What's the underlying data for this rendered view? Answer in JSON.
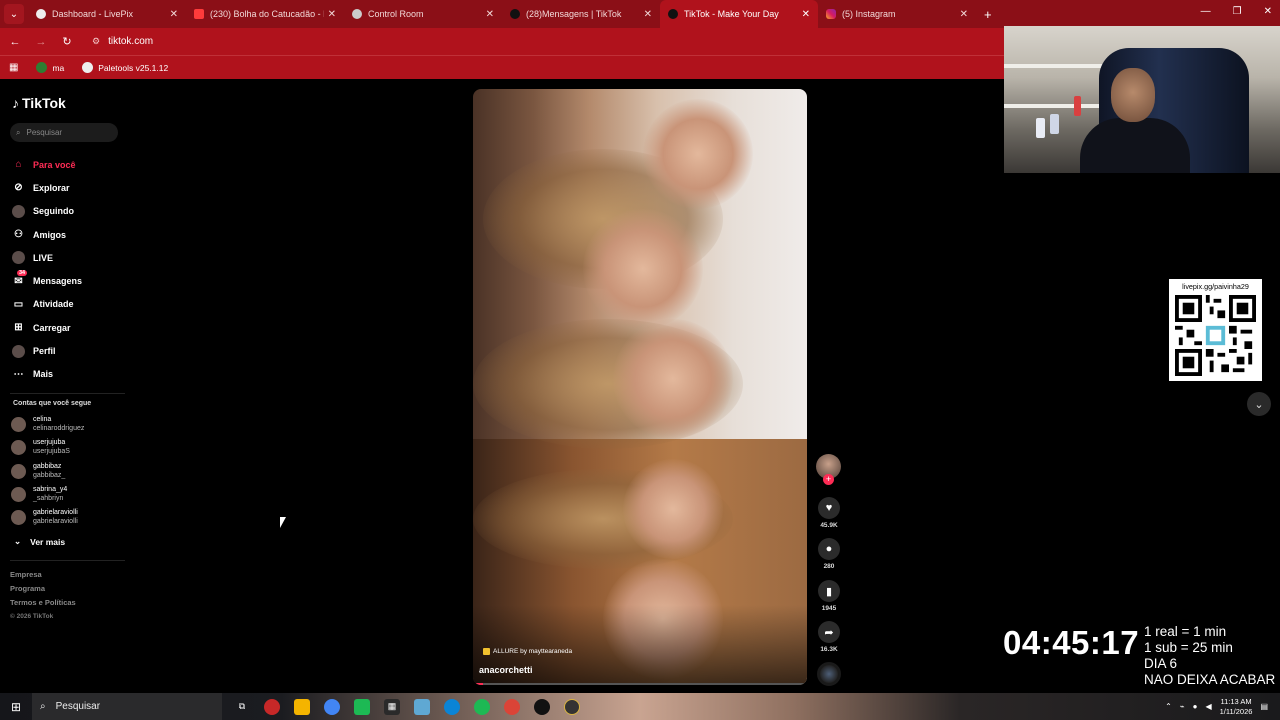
{
  "browser": {
    "tabs": [
      {
        "title": "Dashboard - LivePix",
        "fav": "lp",
        "active": false
      },
      {
        "title": "(230) Bolha do Catucadão - Eu",
        "fav": "yt",
        "active": false
      },
      {
        "title": "Control Room",
        "fav": "cr",
        "active": false
      },
      {
        "title": "(28)Mensagens | TikTok",
        "fav": "tk",
        "active": false
      },
      {
        "title": "TikTok - Make Your Day",
        "fav": "tk",
        "active": true
      },
      {
        "title": "(5) Instagram",
        "fav": "ig",
        "active": false
      }
    ],
    "url": "tiktok.com",
    "bookmarks": [
      {
        "label": "ma"
      },
      {
        "label": "Paletools v25.1.12"
      }
    ],
    "accent": "#b0121c"
  },
  "tiktok": {
    "logo": "TikTok",
    "search_placeholder": "Pesquisar",
    "nav": [
      {
        "label": "Para você",
        "icon": "home-icon",
        "active": true
      },
      {
        "label": "Explorar",
        "icon": "compass-icon",
        "active": false
      },
      {
        "label": "Seguindo",
        "icon": "following-avatar-icon",
        "active": false
      },
      {
        "label": "Amigos",
        "icon": "friends-icon",
        "active": false
      },
      {
        "label": "LIVE",
        "icon": "live-avatar-icon",
        "active": false
      },
      {
        "label": "Mensagens",
        "icon": "messages-icon",
        "active": false,
        "badge": "34"
      },
      {
        "label": "Atividade",
        "icon": "activity-icon",
        "active": false
      },
      {
        "label": "Carregar",
        "icon": "upload-icon",
        "active": false
      },
      {
        "label": "Perfil",
        "icon": "profile-avatar-icon",
        "active": false
      },
      {
        "label": "Mais",
        "icon": "more-icon",
        "active": false
      }
    ],
    "following_title": "Contas que você segue",
    "following": [
      {
        "name": "celina",
        "handle": "celinaroddriguez"
      },
      {
        "name": "userjujuba",
        "handle": "userjujubaS"
      },
      {
        "name": "gabbibaz",
        "handle": "gabbibaz_"
      },
      {
        "name": "sabrina_y4",
        "handle": "_sahbriyn"
      },
      {
        "name": "gabrielaraviolli",
        "handle": "gabrielaraviolli"
      }
    ],
    "see_more": "Ver mais",
    "footer": [
      "Empresa",
      "Programa",
      "Termos e Políticas"
    ],
    "copyright": "© 2026 TikTok",
    "video": {
      "music": "ALLURE by mayttearaneda",
      "author": "anacorchetti",
      "progress": 0.02
    },
    "actions": {
      "likes": "45.9K",
      "comments": "280",
      "saves": "1945",
      "shares": "16.3K"
    }
  },
  "overlay": {
    "qr_label": "livepix.gg/paivinha29",
    "timer": "04:45:17",
    "rules": [
      "1 real = 1 min",
      "1 sub = 25 min",
      "DIA 6",
      "NAO DEIXA ACABAR"
    ]
  },
  "taskbar": {
    "search": "Pesquisar",
    "time": "11:13 AM",
    "date": "1/11/2026"
  }
}
